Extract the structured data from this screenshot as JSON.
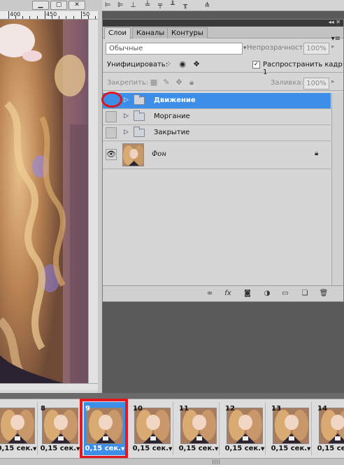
{
  "document": {
    "ruler_labels": [
      "400",
      "450",
      "50"
    ],
    "window_buttons": [
      "minimize",
      "restore",
      "close"
    ]
  },
  "layers_panel": {
    "tabs": [
      {
        "label": "Слои",
        "active": true
      },
      {
        "label": "Каналы",
        "active": false
      },
      {
        "label": "Контуры",
        "active": false
      }
    ],
    "blend_mode": "Обычные",
    "opacity_label": "Непрозрачность:",
    "opacity_value": "100%",
    "unify_label": "Унифицировать:",
    "propagate_label": "Распространить кадр 1",
    "propagate_checked": true,
    "lock_label": "Закрепить:",
    "fill_label": "Заливка:",
    "fill_value": "100%",
    "layers": [
      {
        "name": "Движение",
        "type": "group",
        "selected": true,
        "visible": false
      },
      {
        "name": "Моргание",
        "type": "group",
        "selected": false,
        "visible": false
      },
      {
        "name": "Закрытие",
        "type": "group",
        "selected": false,
        "visible": false
      },
      {
        "name": "Фон",
        "type": "image",
        "selected": false,
        "visible": true,
        "locked": true
      }
    ],
    "footer_icons": [
      "link-icon",
      "fx-icon",
      "mask-icon",
      "adjustment-icon",
      "new-group-icon",
      "new-layer-icon",
      "trash-icon"
    ]
  },
  "timeline": {
    "frames": [
      {
        "number": "",
        "delay": "0,15 сек.",
        "active": false
      },
      {
        "number": "8",
        "delay": "0,15 сек.",
        "active": false
      },
      {
        "number": "9",
        "delay": "0,15 сек.",
        "active": true
      },
      {
        "number": "10",
        "delay": "0,15 сек.",
        "active": false
      },
      {
        "number": "11",
        "delay": "0,15 сек.",
        "active": false
      },
      {
        "number": "12",
        "delay": "0,15 сек.",
        "active": false
      },
      {
        "number": "13",
        "delay": "0,15 сек.",
        "active": false
      },
      {
        "number": "14",
        "delay": "0,15 сек.",
        "active": false
      }
    ]
  },
  "colors": {
    "selection_blue": "#3c8ee8",
    "annotation_red": "#e0161d"
  }
}
